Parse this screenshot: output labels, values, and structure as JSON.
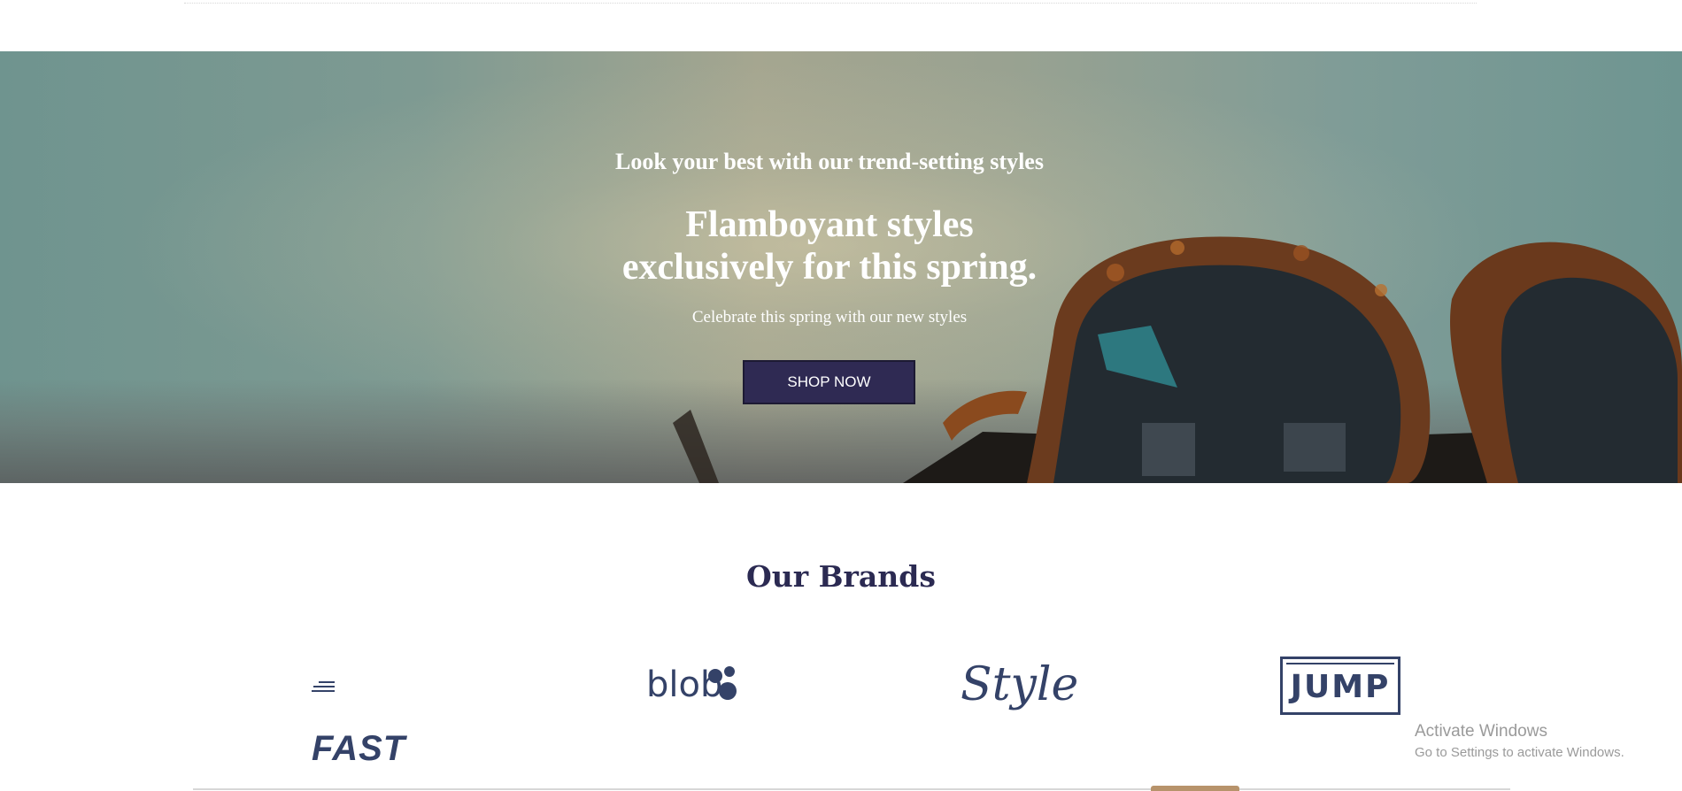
{
  "hero": {
    "kicker": "Look your best with our trend-setting styles",
    "title_line1": "Flamboyant styles",
    "title_line2": "exclusively for this spring.",
    "subtitle": "Celebrate this spring with our new styles",
    "cta_label": "SHOP NOW",
    "background_image": "sunglasses-photo"
  },
  "brands": {
    "heading": "Our Brands",
    "items": [
      {
        "name": "FAST"
      },
      {
        "name": "blob"
      },
      {
        "name": "Style"
      },
      {
        "name": "JUMP"
      }
    ]
  },
  "watermark": {
    "title": "Activate Windows",
    "subtitle": "Go to Settings to activate Windows."
  },
  "colors": {
    "cta_background": "#2f2a53",
    "heading_text": "#2b2a52",
    "brand_logo": "#344268"
  }
}
